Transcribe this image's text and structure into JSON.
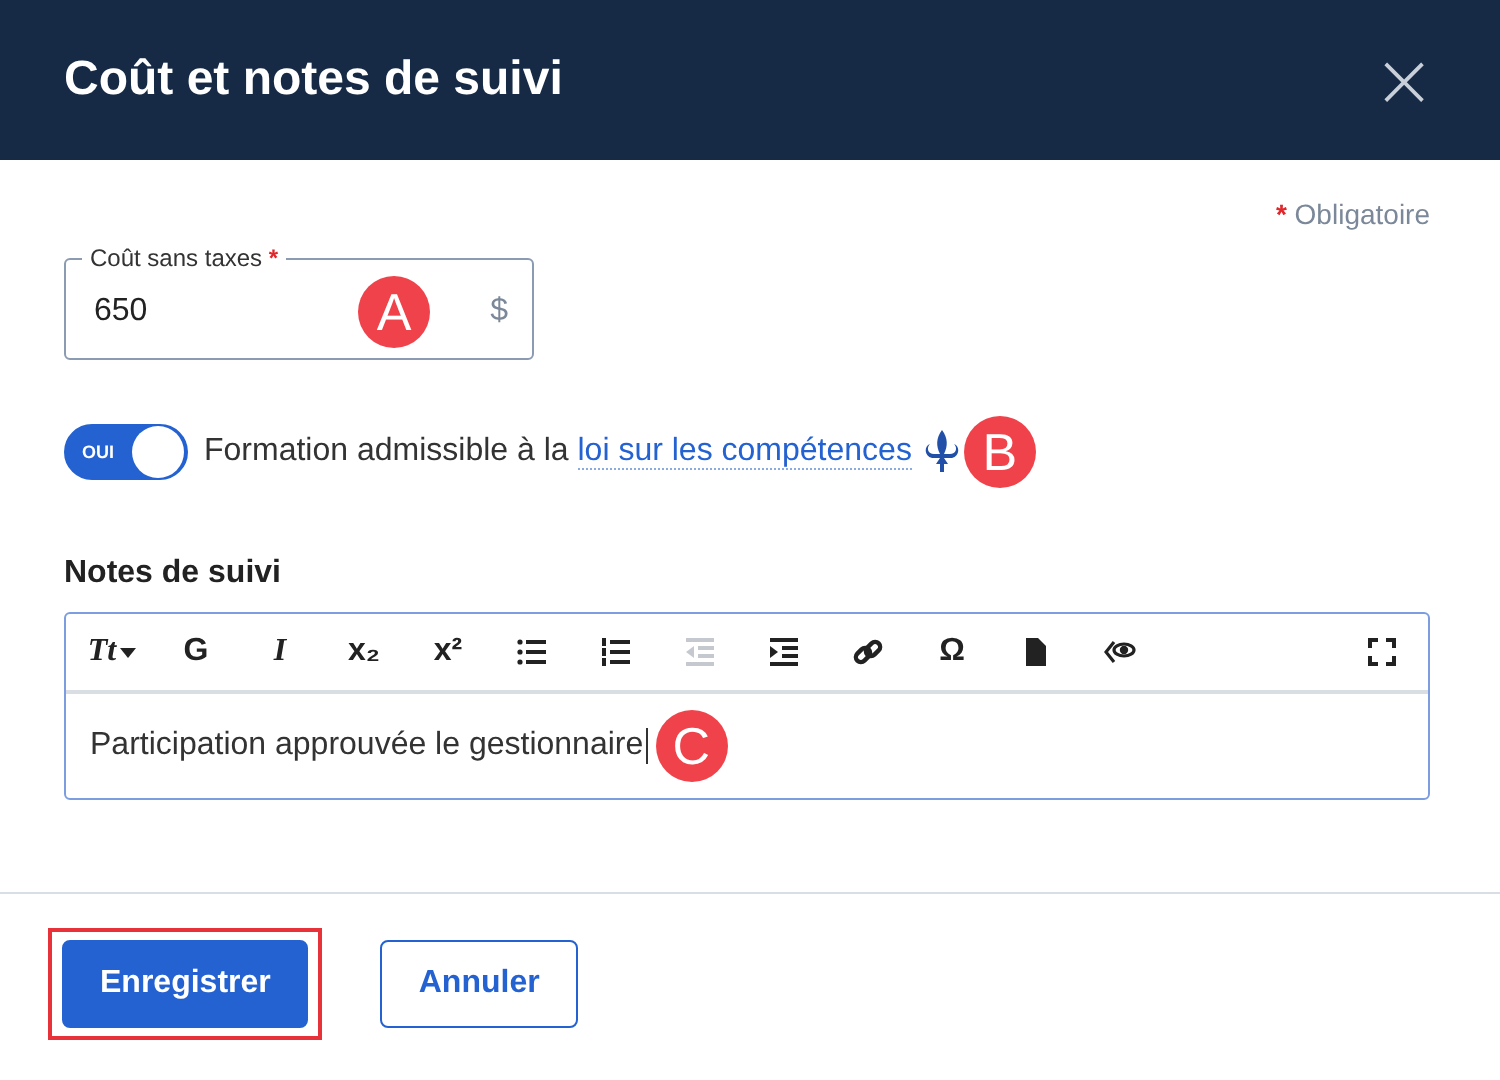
{
  "dialog": {
    "title": "Coût et notes de suivi",
    "close": "×"
  },
  "required_note": {
    "mark": "*",
    "text": "Obligatoire"
  },
  "cost_field": {
    "label": "Coût sans taxes",
    "required_mark": "*",
    "value": "650",
    "suffix": "$",
    "callout": "A"
  },
  "toggle": {
    "on": true,
    "state_label": "OUI",
    "text": "Formation admissible à la",
    "link": "loi sur les compétences",
    "callout": "B"
  },
  "notes": {
    "label": "Notes de suivi",
    "value": "Participation approuvée le gestionnaire",
    "callout": "C",
    "toolbar": [
      {
        "kind": "text-size",
        "label": "Tt",
        "disabled": false
      },
      {
        "kind": "text",
        "label": "G",
        "disabled": false
      },
      {
        "kind": "italic",
        "label": "I",
        "disabled": false
      },
      {
        "kind": "text",
        "label": "x₂",
        "disabled": false
      },
      {
        "kind": "text",
        "label": "x²",
        "disabled": false
      },
      {
        "kind": "bullets",
        "disabled": false
      },
      {
        "kind": "numbers",
        "disabled": false
      },
      {
        "kind": "outdent",
        "disabled": true
      },
      {
        "kind": "indent",
        "disabled": false
      },
      {
        "kind": "link",
        "disabled": false
      },
      {
        "kind": "text",
        "label": "Ω",
        "disabled": false
      },
      {
        "kind": "file",
        "disabled": false
      },
      {
        "kind": "preview",
        "disabled": false
      },
      {
        "kind": "fullscreen",
        "disabled": false
      }
    ]
  },
  "buttons": [
    {
      "label": "Enregistrer",
      "kind": "primary",
      "highlighted": true
    },
    {
      "label": "Annuler",
      "kind": "secondary",
      "highlighted": false
    }
  ]
}
